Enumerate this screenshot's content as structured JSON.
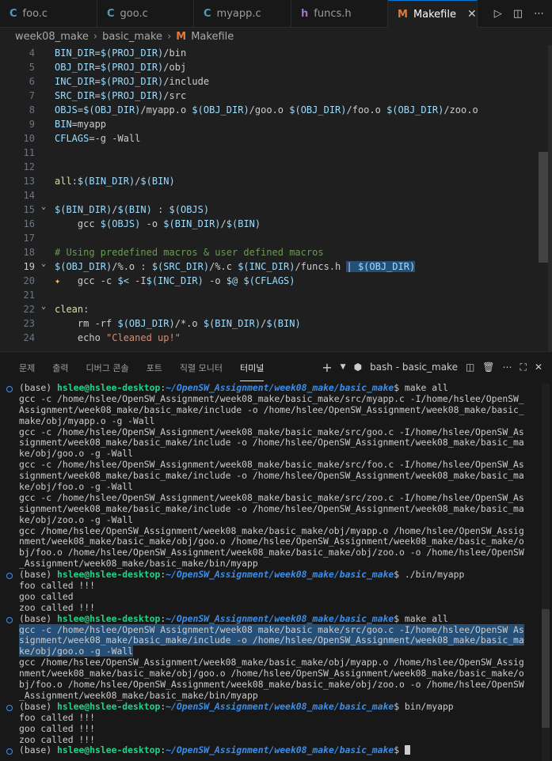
{
  "tabs": [
    {
      "name": "foo.c",
      "icon": "C",
      "iconColor": "#519aba"
    },
    {
      "name": "goo.c",
      "icon": "C",
      "iconColor": "#519aba"
    },
    {
      "name": "myapp.c",
      "icon": "C",
      "iconColor": "#519aba"
    },
    {
      "name": "funcs.h",
      "icon": "h",
      "iconColor": "#a074c4"
    },
    {
      "name": "Makefile",
      "icon": "M",
      "iconColor": "#e37933",
      "active": true
    }
  ],
  "breadcrumb": [
    "week08_make",
    "basic_make",
    "Makefile"
  ],
  "editor": {
    "lines": [
      {
        "n": "4",
        "html": "<span class='v'>BIN_DIR</span>=<span class='v'>$(PROJ_DIR)</span>/bin"
      },
      {
        "n": "5",
        "html": "<span class='v'>OBJ_DIR</span>=<span class='v'>$(PROJ_DIR)</span>/obj"
      },
      {
        "n": "6",
        "html": "<span class='v'>INC_DIR</span>=<span class='v'>$(PROJ_DIR)</span>/include"
      },
      {
        "n": "7",
        "html": "<span class='v'>SRC_DIR</span>=<span class='v'>$(PROJ_DIR)</span>/src"
      },
      {
        "n": "8",
        "html": "<span class='v'>OBJS</span>=<span class='v'>$(OBJ_DIR)</span>/myapp.o <span class='v'>$(OBJ_DIR)</span>/goo.o <span class='v'>$(OBJ_DIR)</span>/foo.o <span class='v'>$(OBJ_DIR)</span>/zoo.o"
      },
      {
        "n": "9",
        "html": "<span class='v'>BIN</span>=myapp"
      },
      {
        "n": "10",
        "html": "<span class='v'>CFLAGS</span>=-g -Wall"
      },
      {
        "n": "11",
        "html": ""
      },
      {
        "n": "12",
        "html": ""
      },
      {
        "n": "13",
        "html": "<span class='kw'>all</span>:<span class='v'>$(BIN_DIR)</span>/<span class='v'>$(BIN)</span>"
      },
      {
        "n": "14",
        "html": ""
      },
      {
        "n": "15",
        "fold": true,
        "html": "<span class='v'>$(BIN_DIR)</span>/<span class='v'>$(BIN)</span> : <span class='v'>$(OBJS)</span>"
      },
      {
        "n": "16",
        "html": "    gcc <span class='v'>$(OBJS)</span> -o <span class='v'>$(BIN_DIR)</span>/<span class='v'>$(BIN)</span>"
      },
      {
        "n": "17",
        "html": ""
      },
      {
        "n": "18",
        "html": "<span class='cm'># Using predefined macros &amp; user defined macros</span>"
      },
      {
        "n": "19",
        "fold": true,
        "cur": true,
        "html": "<span class='v'>$(OBJ_DIR)</span>/%.o : <span class='v'>$(SRC_DIR)</span>/%.c <span class='v'>$(INC_DIR)</span>/funcs.h <span class='hl'>| <span class='v'>$(OBJ_DIR)</span></span>"
      },
      {
        "n": "20",
        "sparkle": true,
        "html": "    gcc -c <span class='v'>$&lt;</span> -I<span class='v'>$(INC_DIR)</span> -o <span class='v'>$@</span> <span class='v'>$(CFLAGS)</span>"
      },
      {
        "n": "21",
        "html": ""
      },
      {
        "n": "22",
        "fold": true,
        "html": "<span class='kw'>clean</span>:"
      },
      {
        "n": "23",
        "html": "    rm -rf <span class='v'>$(OBJ_DIR)</span>/*.o <span class='v'>$(BIN_DIR)</span>/<span class='v'>$(BIN)</span>"
      },
      {
        "n": "24",
        "html": "    echo <span class='st'>\"Cleaned up!\"</span>"
      }
    ]
  },
  "panel": {
    "tabs": [
      "문제",
      "출력",
      "디버그 콘솔",
      "포트",
      "직렬 모니터",
      "터미널"
    ],
    "activeTab": "터미널",
    "terminalName": "bash - basic_make"
  },
  "terminal": {
    "promptBase": "(base) ",
    "promptUser": "hslee@hslee-desktop",
    "promptPath": "~/OpenSW_Assignment/week08_make/basic_make",
    "lines": [
      {
        "t": "prompt",
        "cmd": " make all"
      },
      {
        "t": "text",
        "s": "gcc -c /home/hslee/OpenSW_Assignment/week08_make/basic_make/src/myapp.c -I/home/hslee/OpenSW_"
      },
      {
        "t": "text",
        "s": "Assignment/week08_make/basic_make/include -o /home/hslee/OpenSW_Assignment/week08_make/basic_"
      },
      {
        "t": "text",
        "s": "make/obj/myapp.o -g -Wall"
      },
      {
        "t": "text",
        "s": "gcc -c /home/hslee/OpenSW_Assignment/week08_make/basic_make/src/goo.c -I/home/hslee/OpenSW_As"
      },
      {
        "t": "text",
        "s": "signment/week08_make/basic_make/include -o /home/hslee/OpenSW_Assignment/week08_make/basic_ma"
      },
      {
        "t": "text",
        "s": "ke/obj/goo.o -g -Wall"
      },
      {
        "t": "text",
        "s": "gcc -c /home/hslee/OpenSW_Assignment/week08_make/basic_make/src/foo.c -I/home/hslee/OpenSW_As"
      },
      {
        "t": "text",
        "s": "signment/week08_make/basic_make/include -o /home/hslee/OpenSW_Assignment/week08_make/basic_ma"
      },
      {
        "t": "text",
        "s": "ke/obj/foo.o -g -Wall"
      },
      {
        "t": "text",
        "s": "gcc -c /home/hslee/OpenSW_Assignment/week08_make/basic_make/src/zoo.c -I/home/hslee/OpenSW_As"
      },
      {
        "t": "text",
        "s": "signment/week08_make/basic_make/include -o /home/hslee/OpenSW_Assignment/week08_make/basic_ma"
      },
      {
        "t": "text",
        "s": "ke/obj/zoo.o -g -Wall"
      },
      {
        "t": "text",
        "s": "gcc /home/hslee/OpenSW_Assignment/week08_make/basic_make/obj/myapp.o /home/hslee/OpenSW_Assig"
      },
      {
        "t": "text",
        "s": "nment/week08_make/basic_make/obj/goo.o /home/hslee/OpenSW_Assignment/week08_make/basic_make/o"
      },
      {
        "t": "text",
        "s": "bj/foo.o /home/hslee/OpenSW_Assignment/week08_make/basic_make/obj/zoo.o -o /home/hslee/OpenSW"
      },
      {
        "t": "text",
        "s": "_Assignment/week08_make/basic_make/bin/myapp"
      },
      {
        "t": "prompt",
        "cmd": " ./bin/myapp"
      },
      {
        "t": "text",
        "s": "foo called !!!"
      },
      {
        "t": "text",
        "s": "goo called"
      },
      {
        "t": "text",
        "s": "zoo called !!!"
      },
      {
        "t": "prompt",
        "cmd": " make all"
      },
      {
        "t": "sel",
        "s": "gcc -c /home/hslee/OpenSW_Assignment/week08_make/basic_make/src/goo.c -I/home/hslee/OpenSW_As"
      },
      {
        "t": "sel",
        "s": "signment/week08_make/basic_make/include -o /home/hslee/OpenSW_Assignment/week08_make/basic_ma"
      },
      {
        "t": "sel",
        "s": "ke/obj/goo.o -g -Wall"
      },
      {
        "t": "text",
        "s": "gcc /home/hslee/OpenSW_Assignment/week08_make/basic_make/obj/myapp.o /home/hslee/OpenSW_Assig"
      },
      {
        "t": "text",
        "s": "nment/week08_make/basic_make/obj/goo.o /home/hslee/OpenSW_Assignment/week08_make/basic_make/o"
      },
      {
        "t": "text",
        "s": "bj/foo.o /home/hslee/OpenSW_Assignment/week08_make/basic_make/obj/zoo.o -o /home/hslee/OpenSW"
      },
      {
        "t": "text",
        "s": "_Assignment/week08_make/basic_make/bin/myapp"
      },
      {
        "t": "prompt",
        "cmd": " bin/myapp"
      },
      {
        "t": "text",
        "s": "foo called !!!"
      },
      {
        "t": "text",
        "s": "goo called !!!"
      },
      {
        "t": "text",
        "s": "zoo called !!!"
      },
      {
        "t": "prompt",
        "cmd": " ",
        "cursor": true
      }
    ]
  }
}
